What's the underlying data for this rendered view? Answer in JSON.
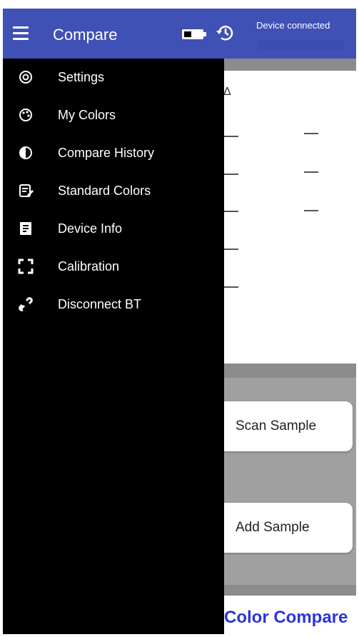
{
  "app_bar": {
    "title": "Compare",
    "device_status": "Device connected",
    "color": "#3f51b5"
  },
  "drawer": {
    "items": [
      {
        "label": "Settings",
        "icon": "settings-icon"
      },
      {
        "label": "My Colors",
        "icon": "palette-icon"
      },
      {
        "label": "Compare History",
        "icon": "compare-icon"
      },
      {
        "label": "Standard Colors",
        "icon": "standard-list-icon"
      },
      {
        "label": "Device Info",
        "icon": "device-info-icon"
      },
      {
        "label": "Calibration",
        "icon": "calibration-icon"
      },
      {
        "label": "Disconnect BT",
        "icon": "link-icon"
      }
    ]
  },
  "main": {
    "delta_symbol": "Δ",
    "scan_button": "Scan Sample",
    "add_button": "Add Sample",
    "footer_title": "Color Compare",
    "accent": "#2a35d8"
  }
}
